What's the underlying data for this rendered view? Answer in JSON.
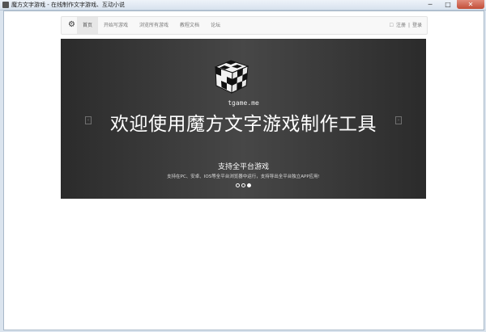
{
  "window": {
    "title": "魔方文字游戏 - 在线制作文字游戏、互动小说",
    "buttons": {
      "minimize": "─",
      "maximize": "□",
      "close": "✕"
    }
  },
  "navbar": {
    "brand_icon": "gear-icon",
    "items": [
      {
        "label": "首页",
        "active": true
      },
      {
        "label": "开始写游戏",
        "active": false
      },
      {
        "label": "浏览所有游戏",
        "active": false
      },
      {
        "label": "教程文档",
        "active": false
      },
      {
        "label": "论坛",
        "active": false
      }
    ],
    "user_icon": "user-icon",
    "register_label": "注册",
    "separator": "|",
    "login_label": "登录"
  },
  "carousel": {
    "logo_icon": "rubiks-cube-icon",
    "domain": "tgame.me",
    "headline": "欢迎使用魔方文字游戏制作工具",
    "subtitle": "支持全平台游戏",
    "description": "支持在PC、安卓、IOS等全平台浏览器中运行，支持导出全平台独立APP应用!",
    "prev_label": "‹",
    "next_label": "›",
    "slide_count": 3,
    "active_slide_index": 2
  },
  "colors": {
    "carousel_bg": "#3a3a3a",
    "navbar_bg": "#f8f8f8",
    "active_nav_bg": "#e7e7e7"
  }
}
